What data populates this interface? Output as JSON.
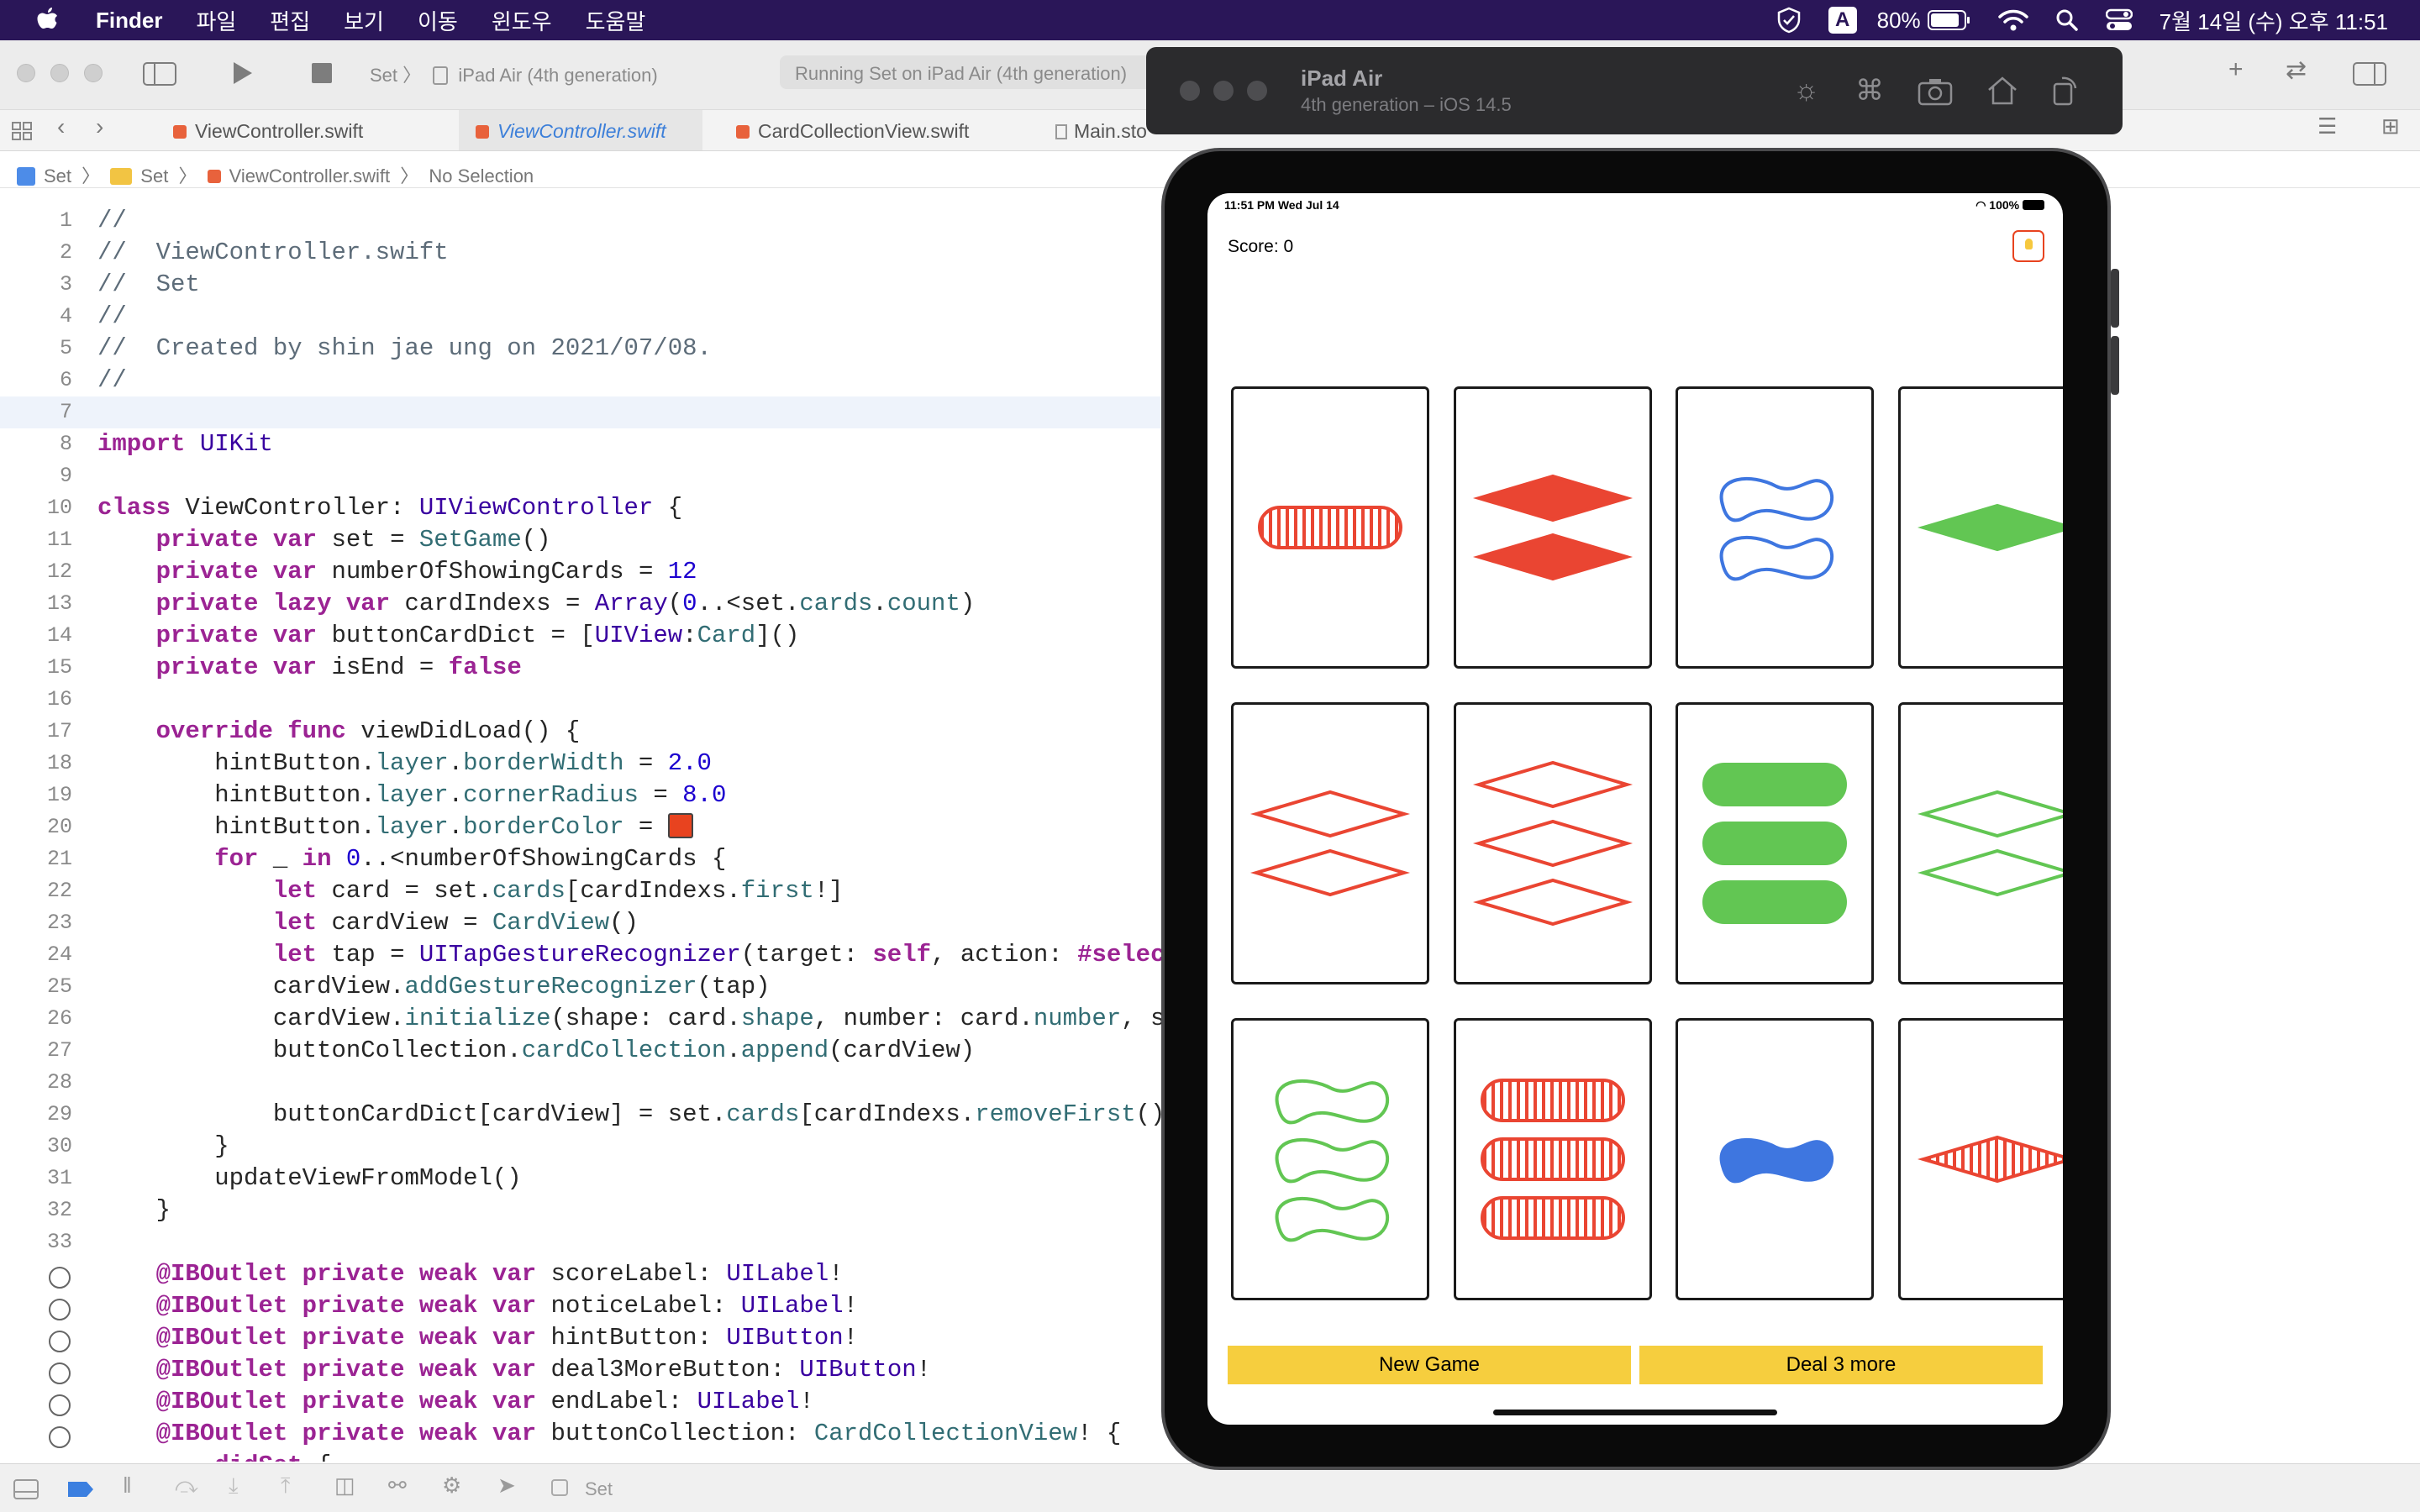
{
  "menubar": {
    "app_name": "Finder",
    "menus": [
      "파일",
      "편집",
      "보기",
      "이동",
      "윈도우",
      "도움말"
    ],
    "input_source": "A",
    "battery": "80%",
    "datetime": "7월 14일 (수) 오후 11:51"
  },
  "toolbar": {
    "scheme": "Set 〉",
    "destination": "iPad Air (4th generation)",
    "activity": "Running Set on iPad Air (4th generation)"
  },
  "tabs": [
    {
      "label": "ViewController.swift",
      "active": false
    },
    {
      "label": "ViewController.swift",
      "active": true
    },
    {
      "label": "CardCollectionView.swift",
      "active": false
    },
    {
      "label": "Main.storyboard (Base)",
      "active": false
    }
  ],
  "jumpbar": [
    "Set",
    "Set",
    "ViewController.swift",
    "No Selection"
  ],
  "editor": {
    "current_line": 7,
    "lines": [
      {
        "n": "1",
        "t": "//"
      },
      {
        "n": "2",
        "t": "//  ViewController.swift"
      },
      {
        "n": "3",
        "t": "//  Set"
      },
      {
        "n": "4",
        "t": "//"
      },
      {
        "n": "5",
        "t": "//  Created by shin jae ung on 2021/07/08."
      },
      {
        "n": "6",
        "t": "//"
      },
      {
        "n": "7",
        "t": ""
      },
      {
        "n": "8",
        "t": "import UIKit"
      },
      {
        "n": "9",
        "t": ""
      },
      {
        "n": "10",
        "t": "class ViewController: UIViewController {"
      },
      {
        "n": "11",
        "t": "    private var set = SetGame()"
      },
      {
        "n": "12",
        "t": "    private var numberOfShowingCards = 12"
      },
      {
        "n": "13",
        "t": "    private lazy var cardIndexs = Array(0..<set.cards.count)"
      },
      {
        "n": "14",
        "t": "    private var buttonCardDict = [UIView:Card]()"
      },
      {
        "n": "15",
        "t": "    private var isEnd = false"
      },
      {
        "n": "16",
        "t": ""
      },
      {
        "n": "17",
        "t": "    override func viewDidLoad() {"
      },
      {
        "n": "18",
        "t": "        hintButton.layer.borderWidth = 2.0"
      },
      {
        "n": "19",
        "t": "        hintButton.layer.cornerRadius = 8.0"
      },
      {
        "n": "20",
        "t": "        hintButton.layer.borderColor = "
      },
      {
        "n": "21",
        "t": "        for _ in 0..<numberOfShowingCards {"
      },
      {
        "n": "22",
        "t": "            let card = set.cards[cardIndexs.first!]"
      },
      {
        "n": "23",
        "t": "            let cardView = CardView()"
      },
      {
        "n": "24",
        "t": "            let tap = UITapGestureRecognizer(target: self, action: #selec"
      },
      {
        "n": "25",
        "t": "            cardView.addGestureRecognizer(tap)"
      },
      {
        "n": "26",
        "t": "            cardView.initialize(shape: card.shape, number: card.number, s"
      },
      {
        "n": "27",
        "t": "            buttonCollection.cardCollection.append(cardView)"
      },
      {
        "n": "28",
        "t": ""
      },
      {
        "n": "29",
        "t": "            buttonCardDict[cardView] = set.cards[cardIndexs.removeFirst()"
      },
      {
        "n": "30",
        "t": "        }"
      },
      {
        "n": "31",
        "t": "        updateViewFromModel()"
      },
      {
        "n": "32",
        "t": "    }"
      },
      {
        "n": "33",
        "t": ""
      },
      {
        "n": "",
        "t": "    @IBOutlet private weak var scoreLabel: UILabel!",
        "outlet": true
      },
      {
        "n": "",
        "t": "    @IBOutlet private weak var noticeLabel: UILabel!",
        "outlet": true
      },
      {
        "n": "",
        "t": "    @IBOutlet private weak var hintButton: UIButton!",
        "outlet": true
      },
      {
        "n": "",
        "t": "    @IBOutlet private weak var deal3MoreButton: UIButton!",
        "outlet": true
      },
      {
        "n": "",
        "t": "    @IBOutlet private weak var endLabel: UILabel!",
        "outlet": true
      },
      {
        "n": "",
        "t": "    @IBOutlet private weak var buttonCollection: CardCollectionView! {",
        "outlet": true
      },
      {
        "n": "",
        "t": "        didSet {"
      }
    ]
  },
  "bottombar": {
    "scheme": "Set"
  },
  "simulator": {
    "title": "iPad Air",
    "subtitle": "4th generation – iOS 14.5",
    "status_time": "11:51 PM  Wed Jul 14",
    "status_battery": "100%",
    "score_label": "Score: 0",
    "new_game_label": "New Game",
    "deal_label": "Deal 3 more",
    "colors": {
      "red": "#ea4532",
      "green": "#62c653",
      "blue": "#3e76e0",
      "button": "#f6ce3e"
    },
    "cards": [
      {
        "shape": "oval",
        "count": 1,
        "color": "red",
        "fill": "striped"
      },
      {
        "shape": "diamond",
        "count": 2,
        "color": "red",
        "fill": "solid"
      },
      {
        "shape": "squiggle",
        "count": 2,
        "color": "blue",
        "fill": "outline"
      },
      {
        "shape": "diamond",
        "count": 1,
        "color": "green",
        "fill": "solid"
      },
      {
        "shape": "diamond",
        "count": 2,
        "color": "red",
        "fill": "outline"
      },
      {
        "shape": "diamond",
        "count": 3,
        "color": "red",
        "fill": "outline"
      },
      {
        "shape": "oval",
        "count": 3,
        "color": "green",
        "fill": "solid"
      },
      {
        "shape": "diamond",
        "count": 2,
        "color": "green",
        "fill": "outline"
      },
      {
        "shape": "squiggle",
        "count": 3,
        "color": "green",
        "fill": "outline"
      },
      {
        "shape": "oval",
        "count": 3,
        "color": "red",
        "fill": "striped"
      },
      {
        "shape": "squiggle",
        "count": 1,
        "color": "blue",
        "fill": "solid"
      },
      {
        "shape": "diamond",
        "count": 1,
        "color": "red",
        "fill": "striped"
      }
    ]
  }
}
